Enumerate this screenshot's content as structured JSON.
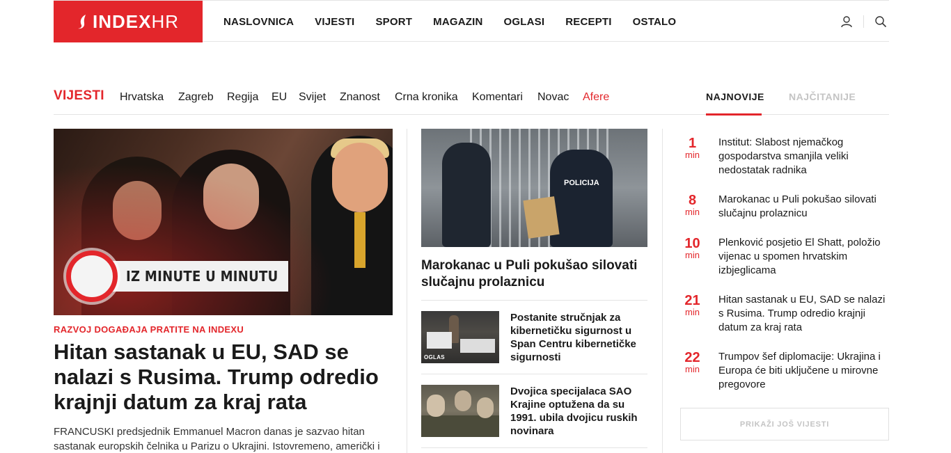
{
  "brand": {
    "logo_main": "INDEX",
    "logo_suffix": "HR",
    "accent_color": "#e3262b"
  },
  "main_nav": {
    "items": [
      "NASLOVNICA",
      "VIJESTI",
      "SPORT",
      "MAGAZIN",
      "OGLASI",
      "RECEPTI",
      "OSTALO"
    ],
    "icons": [
      "user-icon",
      "search-icon"
    ]
  },
  "section_nav": {
    "title": "VIJESTI",
    "items": [
      "Hrvatska",
      "Zagreb",
      "Regija",
      "EU",
      "Svijet",
      "Znanost",
      "Crna kronika",
      "Komentari",
      "Novac",
      "Afere"
    ],
    "highlighted": "Afere"
  },
  "tabs": {
    "active": "NAJNOVIJE",
    "inactive": "NAJČITANIJE"
  },
  "lead": {
    "badge": "IZ MINUTE U MINUTU",
    "kicker": "RAZVOJ DOGAĐAJA PRATITE NA INDEXU",
    "title": "Hitan sastanak u EU, SAD se nalazi s Rusima. Trump odredio krajnji datum za kraj rata",
    "text": "FRANCUSKI predsjednik Emmanuel Macron danas je sazvao hitan sastanak europskih čelnika u Parizu o Ukrajini. Istovremeno, američki i"
  },
  "middle": {
    "image_label": "POLICIJA",
    "title": "Marokanac u Puli pokušao silovati slučajnu prolaznicu",
    "items": [
      {
        "title": "Postanite stručnjak za kibernetičku sigurnost u Span Centru kibernetičke sigurnosti",
        "tag": "OGLAS"
      },
      {
        "title": "Dvojica specijalaca SAO Krajine optužena da su 1991. ubila dvojicu ruskih novinara",
        "tag": ""
      }
    ]
  },
  "latest": {
    "items": [
      {
        "num": "1",
        "unit": "min",
        "title": "Institut: Slabost njemačkog gospodarstva smanjila veliki nedostatak radnika"
      },
      {
        "num": "8",
        "unit": "min",
        "title": "Marokanac u Puli pokušao silovati slučajnu prolaznicu"
      },
      {
        "num": "10",
        "unit": "min",
        "title": "Plenković posjetio El Shatt, položio vijenac u spomen hrvatskim izbjeglicama"
      },
      {
        "num": "21",
        "unit": "min",
        "title": "Hitan sastanak u EU, SAD se nalazi s Rusima. Trump odredio krajnji datum za kraj rata"
      },
      {
        "num": "22",
        "unit": "min",
        "title": "Trumpov šef diplomacije: Ukrajina i Europa će biti uključene u mirovne pregovore"
      }
    ],
    "more_label": "PRIKAŽI JOŠ VIJESTI"
  }
}
